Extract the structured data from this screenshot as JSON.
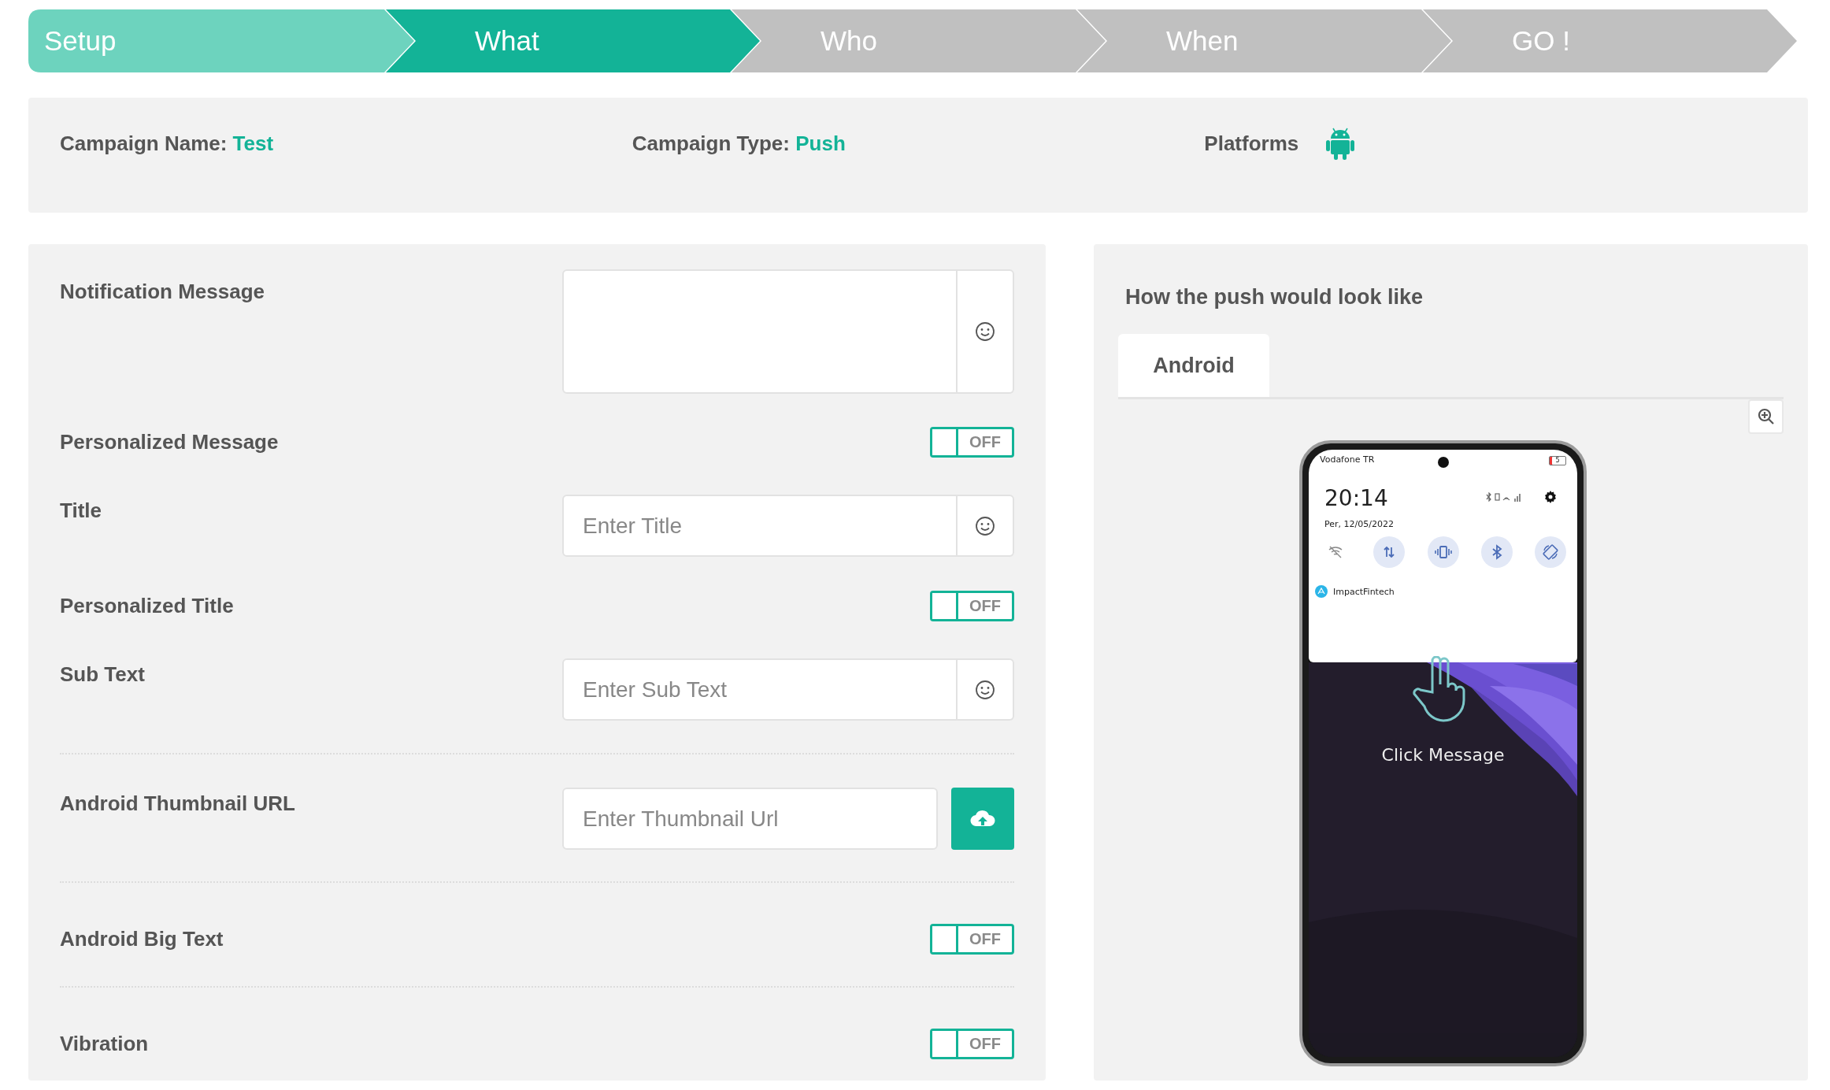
{
  "steps": [
    {
      "label": "Setup",
      "kind": "done"
    },
    {
      "label": "What",
      "kind": "current"
    },
    {
      "label": "Who",
      "kind": "todo"
    },
    {
      "label": "When",
      "kind": "todo"
    },
    {
      "label": "GO !",
      "kind": "todo"
    }
  ],
  "summary": {
    "campaign_name": {
      "label": "Campaign Name:",
      "value": "Test"
    },
    "campaign_type": {
      "label": "Campaign Type:",
      "value": "Push"
    },
    "platforms": {
      "label": "Platforms"
    }
  },
  "form": {
    "rows": [
      {
        "kind": "textarea",
        "label": "Notification Message",
        "divider": false
      },
      {
        "kind": "toggle",
        "label": "Personalized Message",
        "checked": false,
        "state_text": "OFF",
        "divider": false
      },
      {
        "kind": "input",
        "label": "Title",
        "placeholder": "Enter Title",
        "divider": false
      },
      {
        "kind": "toggle",
        "label": "Personalized Title",
        "checked": false,
        "state_text": "OFF",
        "divider": false
      },
      {
        "kind": "input",
        "label": "Sub Text",
        "placeholder": "Enter Sub Text",
        "divider": false
      },
      {
        "kind": "upload",
        "label": "Android Thumbnail URL",
        "placeholder": "Enter Thumbnail Url",
        "divider": true
      },
      {
        "kind": "toggle",
        "label": "Android Big Text",
        "checked": false,
        "state_text": "OFF",
        "divider": true
      },
      {
        "kind": "toggle",
        "label": "Vibration",
        "checked": false,
        "state_text": "OFF",
        "divider": true
      }
    ]
  },
  "preview": {
    "title": "How the push would look like",
    "tabs": [
      {
        "label": "Android",
        "selected": true
      }
    ],
    "phone": {
      "carrier": "Vodafone TR",
      "battery": "5",
      "time": "20:14",
      "date": "Per, 12/05/2022",
      "app_name": "ImpactFintech",
      "hint": "Click Message"
    }
  }
}
